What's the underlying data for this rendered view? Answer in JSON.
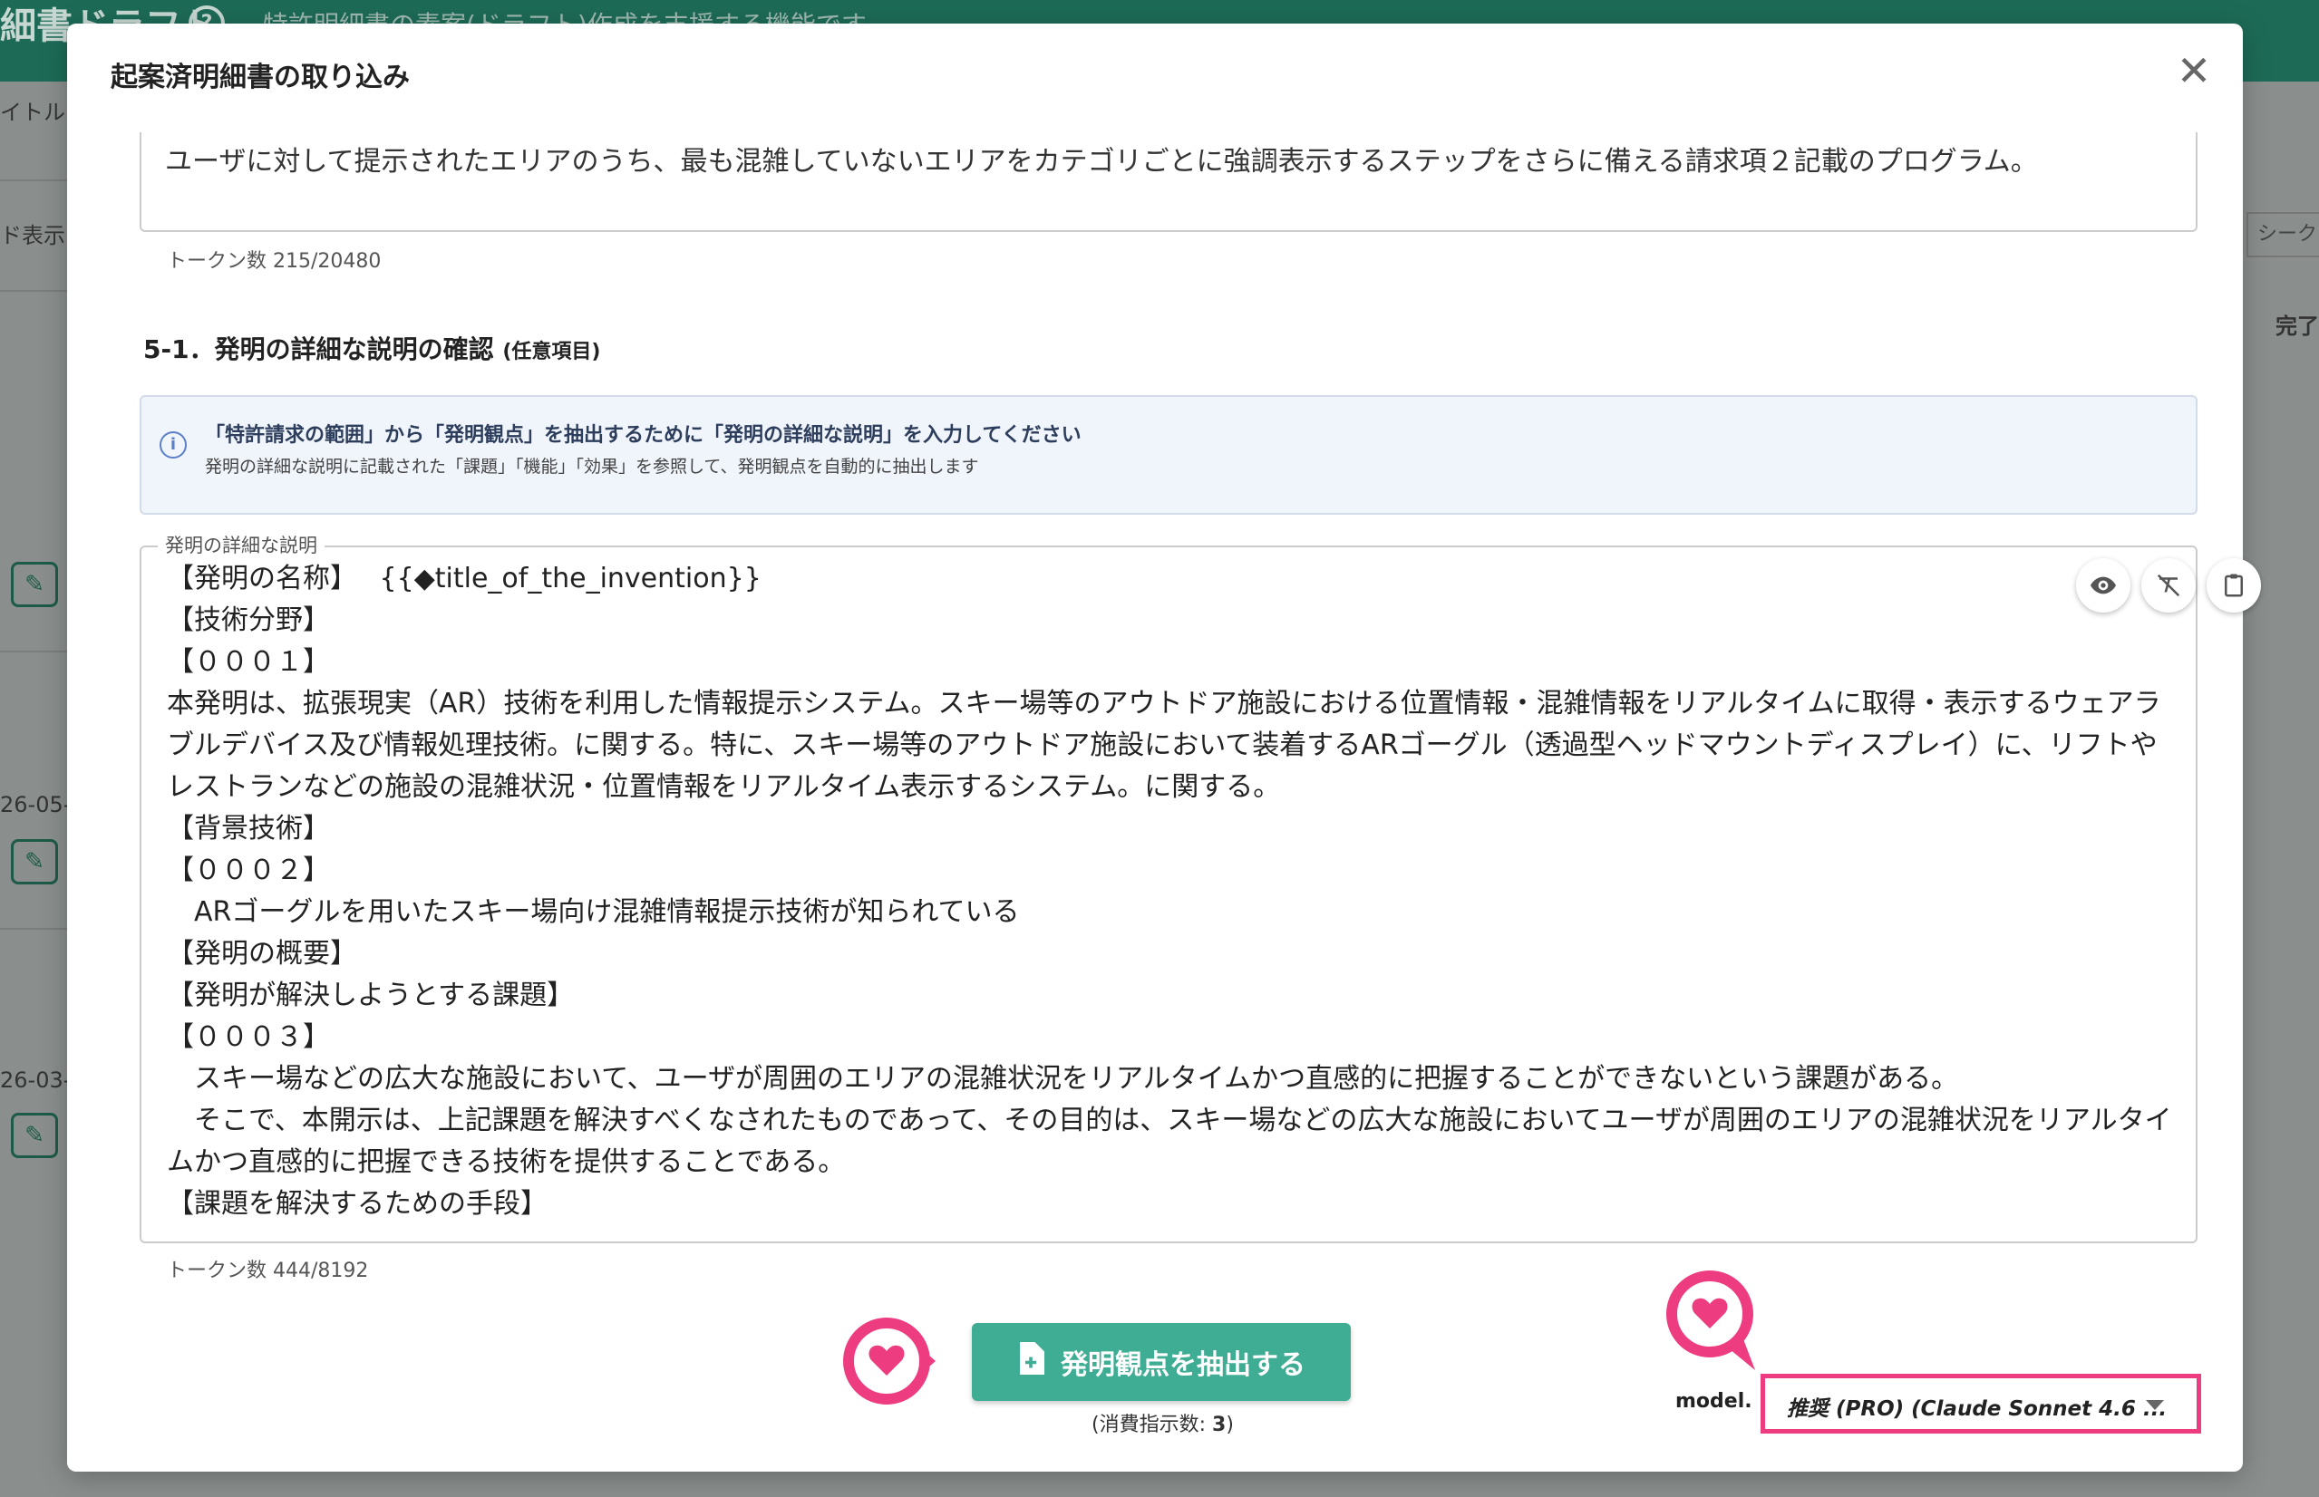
{
  "background": {
    "app_title": "細書ドラフト",
    "app_description": "特許明細書の素案(ドラフト)作成を支援する機能です",
    "help_glyph": "?",
    "left_labels": [
      "イトル",
      "ド表示"
    ],
    "dates": [
      "26-05-",
      "26-03-"
    ],
    "right_labels": [
      "シーク",
      "完了"
    ]
  },
  "modal": {
    "title": "起案済明細書の取り込み",
    "close_glyph": "✕",
    "claims_text": "ユーザに対して提示されたエリアのうち、最も混雑していないエリアをカテゴリごとに強調表示するステップをさらに備える請求項２記載のプログラム。",
    "claims_token_count": "トークン数 215/20480",
    "section": {
      "heading": "5-1．発明の詳細な説明の確認",
      "optional": "(任意項目)"
    },
    "info": {
      "title": "「特許請求の範囲」から「発明観点」を抽出するために「発明の詳細な説明」を入力してください",
      "subtitle": "発明の詳細な説明に記載された「課題」「機能」「効果」を参照して、発明観点を自動的に抽出します"
    },
    "description_field": {
      "legend": "発明の詳細な説明",
      "text": "【発明の名称】　 {{◆title_of_the_invention}}\n【技術分野】\n【０００１】\n本発明は、拡張現実（AR）技術を利用した情報提示システム。スキー場等のアウトドア施設における位置情報・混雑情報をリアルタイムに取得・表示するウェアラブルデバイス及び情報処理技術。に関する。特に、スキー場等のアウトドア施設において装着するARゴーグル（透過型ヘッドマウントディスプレイ）に、リフトやレストランなどの施設の混雑状況・位置情報をリアルタイム表示するシステム。に関する。\n【背景技術】\n【０００２】\n　ARゴーグルを用いたスキー場向け混雑情報提示技術が知られている\n【発明の概要】\n【発明が解決しようとする課題】\n【０００３】\n　スキー場などの広大な施設において、ユーザが周囲のエリアの混雑状況をリアルタイムかつ直感的に把握することができないという課題がある。\n　そこで、本開示は、上記課題を解決すべくなされたものであって、その目的は、スキー場などの広大な施設においてユーザが周囲のエリアの混雑状況をリアルタイムかつ直感的に把握できる技術を提供することである。\n【課題を解決するための手段】",
      "token_count": "トークン数 444/8192",
      "tools": [
        "eye-icon",
        "clear-format-icon",
        "clipboard-icon"
      ]
    },
    "extract_button": {
      "label": "発明観点を抽出する",
      "icon": "document-add-icon"
    },
    "consumption": {
      "prefix": "(消費指示数: ",
      "value": "3",
      "suffix": ")"
    },
    "model": {
      "label": "model.",
      "selected": "推奨 (PRO) (Claude Sonnet 4.6 ..."
    }
  },
  "colors": {
    "header": "#1d6b57",
    "primary_button": "#3fad93",
    "highlight": "#ee3c80",
    "info_bg": "#f0f4fb"
  }
}
